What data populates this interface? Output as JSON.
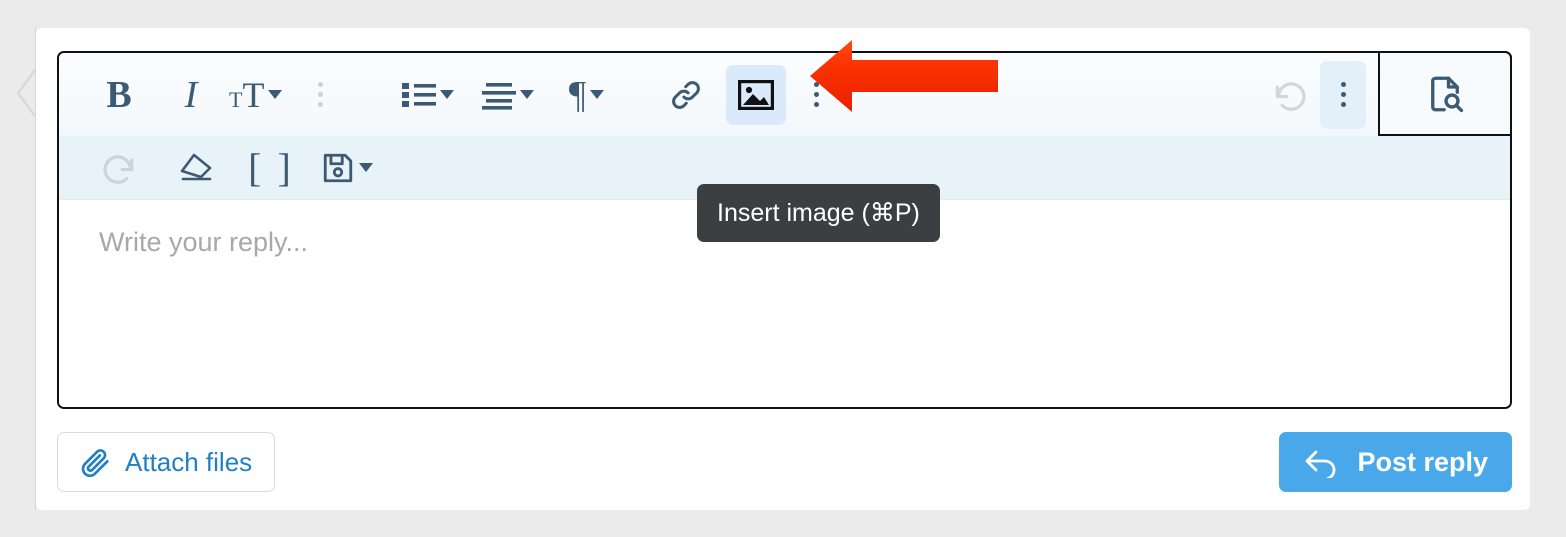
{
  "editor": {
    "placeholder": "Write your reply...",
    "body_text": "",
    "tooltip": "Insert image (⌘P)",
    "toolbar_row1": [
      {
        "name": "bold-button",
        "label": "B",
        "icon": "bold-icon",
        "state": "enabled"
      },
      {
        "name": "italic-button",
        "label": "I",
        "icon": "italic-icon",
        "state": "enabled"
      },
      {
        "name": "font-size-button",
        "label": "ᴛT",
        "icon": "font-size-icon",
        "state": "enabled",
        "has_caret": true
      },
      {
        "name": "text-overflow-menu-button",
        "label": "",
        "icon": "kebab-menu-icon",
        "state": "dimmed"
      },
      {
        "name": "bullet-list-button",
        "label": "",
        "icon": "bullet-list-icon",
        "state": "enabled",
        "has_caret": true
      },
      {
        "name": "align-button",
        "label": "",
        "icon": "align-left-icon",
        "state": "enabled",
        "has_caret": true
      },
      {
        "name": "paragraph-style-button",
        "label": "¶",
        "icon": "pilcrow-icon",
        "state": "enabled",
        "has_caret": true
      },
      {
        "name": "insert-link-button",
        "label": "",
        "icon": "link-icon",
        "state": "enabled"
      },
      {
        "name": "insert-image-button",
        "label": "",
        "icon": "image-icon",
        "state": "highlighted"
      },
      {
        "name": "insert-overflow-menu-button",
        "label": "",
        "icon": "kebab-menu-icon",
        "state": "enabled"
      },
      {
        "name": "undo-button",
        "label": "",
        "icon": "undo-icon",
        "state": "disabled"
      },
      {
        "name": "history-overflow-menu-button",
        "label": "",
        "icon": "kebab-menu-icon",
        "state": "highlighted-soft"
      }
    ],
    "toolbar_row2": [
      {
        "name": "redo-button",
        "label": "",
        "icon": "redo-icon",
        "state": "disabled"
      },
      {
        "name": "clear-formatting-button",
        "label": "",
        "icon": "eraser-icon",
        "state": "enabled"
      },
      {
        "name": "insert-code-button",
        "label": "[ ]",
        "icon": "brackets-icon",
        "state": "enabled"
      },
      {
        "name": "save-draft-button",
        "label": "",
        "icon": "floppy-disk-icon",
        "state": "enabled",
        "has_caret": true
      }
    ],
    "preview_button": {
      "name": "preview-document-button",
      "icon": "document-search-icon"
    }
  },
  "actions": {
    "attach_label": "Attach files",
    "attach_icon": "paperclip-icon",
    "post_label": "Post reply",
    "post_icon": "reply-arrow-icon"
  },
  "annotation": {
    "arrow": "red-left-arrow",
    "points_to": "insert-image-button"
  },
  "colors": {
    "page_background": "#ebebeb",
    "card_background": "#ffffff",
    "toolbar_row1": "#f7fafd",
    "toolbar_row2": "#e8f2f9",
    "icon": "#3c5a73",
    "icon_disabled": "#cfd4d8",
    "highlight": "#dbeafb",
    "accent_blue": "#2180c4",
    "post_button": "#49a8ea",
    "tooltip_background": "#3c3f41",
    "annotation_red": "#f53000",
    "editor_border": "#111111",
    "placeholder_text": "#a8a8a8"
  }
}
